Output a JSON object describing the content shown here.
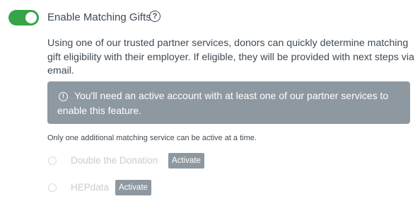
{
  "matching_gifts": {
    "toggle_on": true,
    "label": "Enable Matching Gifts",
    "help_icon": "question-circle-icon",
    "description": "Using one of our trusted partner services, donors can quickly determine matching gift eligibility with their employer. If eligible, they will be provided with next steps via email."
  },
  "info": {
    "icon": "info-circle-icon",
    "message": "You'll need an active account with at least one of our partner services to enable this feature."
  },
  "note": "Only one additional matching service can be active at a time.",
  "services": [
    {
      "name": "Double the Donation",
      "selected": false,
      "button_label": "Activate"
    },
    {
      "name": "HEPdata",
      "selected": false,
      "button_label": "Activate"
    }
  ],
  "colors": {
    "toggle_on": "#37a447",
    "info_background": "#8e98a1",
    "text": "#3f4a55",
    "disabled_text": "#c8ccd1"
  }
}
